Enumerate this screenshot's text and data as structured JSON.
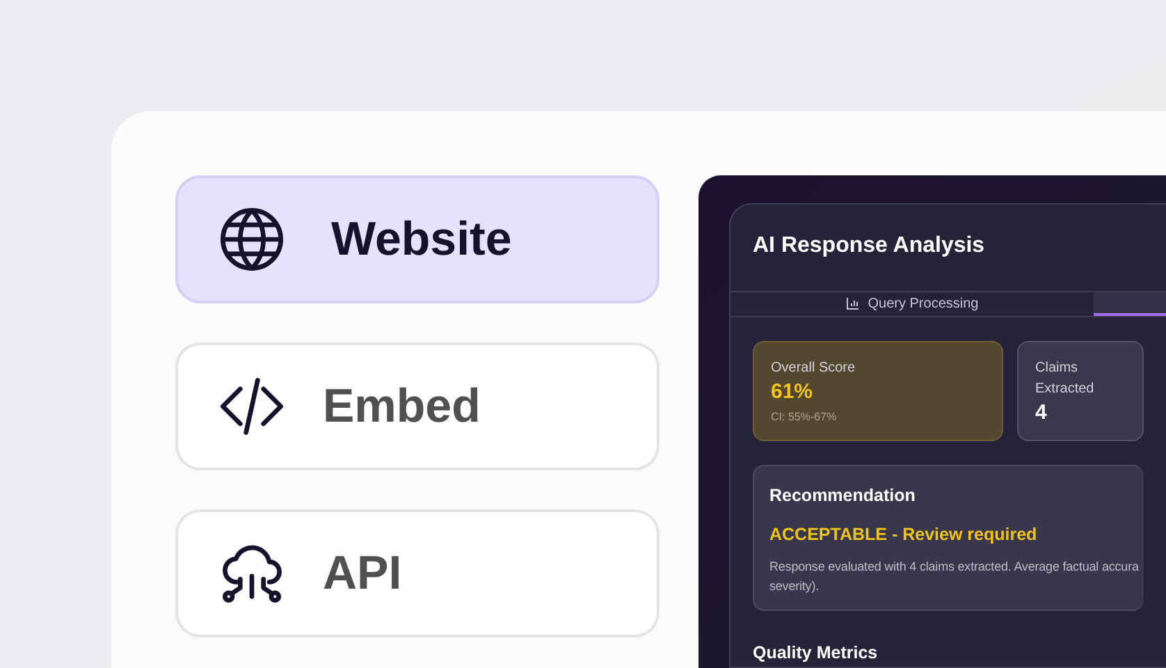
{
  "options": [
    {
      "kind": "globe",
      "label": "Website",
      "selected": true
    },
    {
      "kind": "code",
      "label": "Embed",
      "selected": false
    },
    {
      "kind": "cloud",
      "label": "API",
      "selected": false
    }
  ],
  "analysis": {
    "title": "AI Response Analysis",
    "tabs": [
      {
        "label": "Query Processing",
        "selected": false
      },
      {
        "selected": true
      }
    ],
    "metrics": [
      {
        "kind": "highlight",
        "label": "Overall Score",
        "value": "61%",
        "note": "CI: 55%-67%"
      },
      {
        "kind": "plain",
        "label": "Claims Extracted",
        "value": "4"
      }
    ],
    "recommendation": {
      "title": "Recommendation",
      "verdict": "ACCEPTABLE - Review required",
      "lines": [
        "Response evaluated with 4 claims extracted. Average factual accura",
        "severity)."
      ]
    },
    "section_title": "Quality Metrics"
  }
}
